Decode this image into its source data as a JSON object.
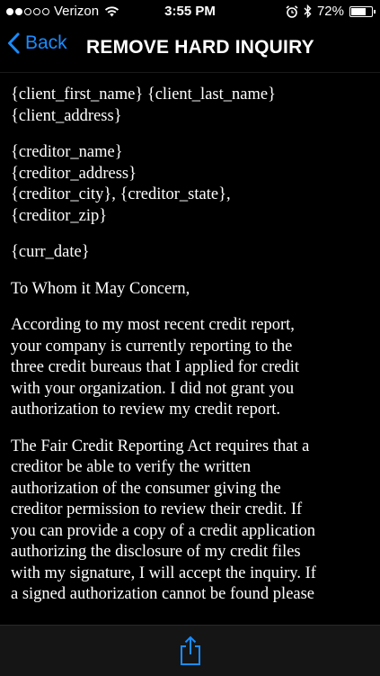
{
  "status_bar": {
    "carrier": "Verizon",
    "time": "3:55 PM",
    "battery_percent": "72%",
    "battery_level": 0.72,
    "signal_filled": 2,
    "signal_total": 5
  },
  "nav": {
    "back_label": "Back",
    "title": "REMOVE HARD INQUIRY",
    "accent_color": "#1a8cff"
  },
  "letter": {
    "client_block": [
      "{client_first_name} {client_last_name}",
      "{client_address}"
    ],
    "creditor_block": [
      "{creditor_name}",
      "{creditor_address}",
      "{creditor_city}, {creditor_state},",
      "{creditor_zip}"
    ],
    "date_line": "{curr_date}",
    "salutation": "To Whom it May Concern,",
    "paragraph1": [
      "According to my most recent credit report,",
      "your company is currently reporting to the",
      "three credit bureaus that I applied for credit",
      "with your organization. I did not grant you",
      "authorization to review my credit report."
    ],
    "paragraph2": [
      "The Fair Credit Reporting Act requires that a",
      "creditor be able to verify the written",
      "authorization of the consumer giving the",
      "creditor permission to review their credit. If",
      "you can provide a copy of a credit application",
      "authorizing the disclosure of my credit files",
      "with my signature, I will accept the inquiry. If",
      "a signed authorization cannot be found please"
    ]
  },
  "toolbar": {
    "share_icon": "share-icon"
  }
}
